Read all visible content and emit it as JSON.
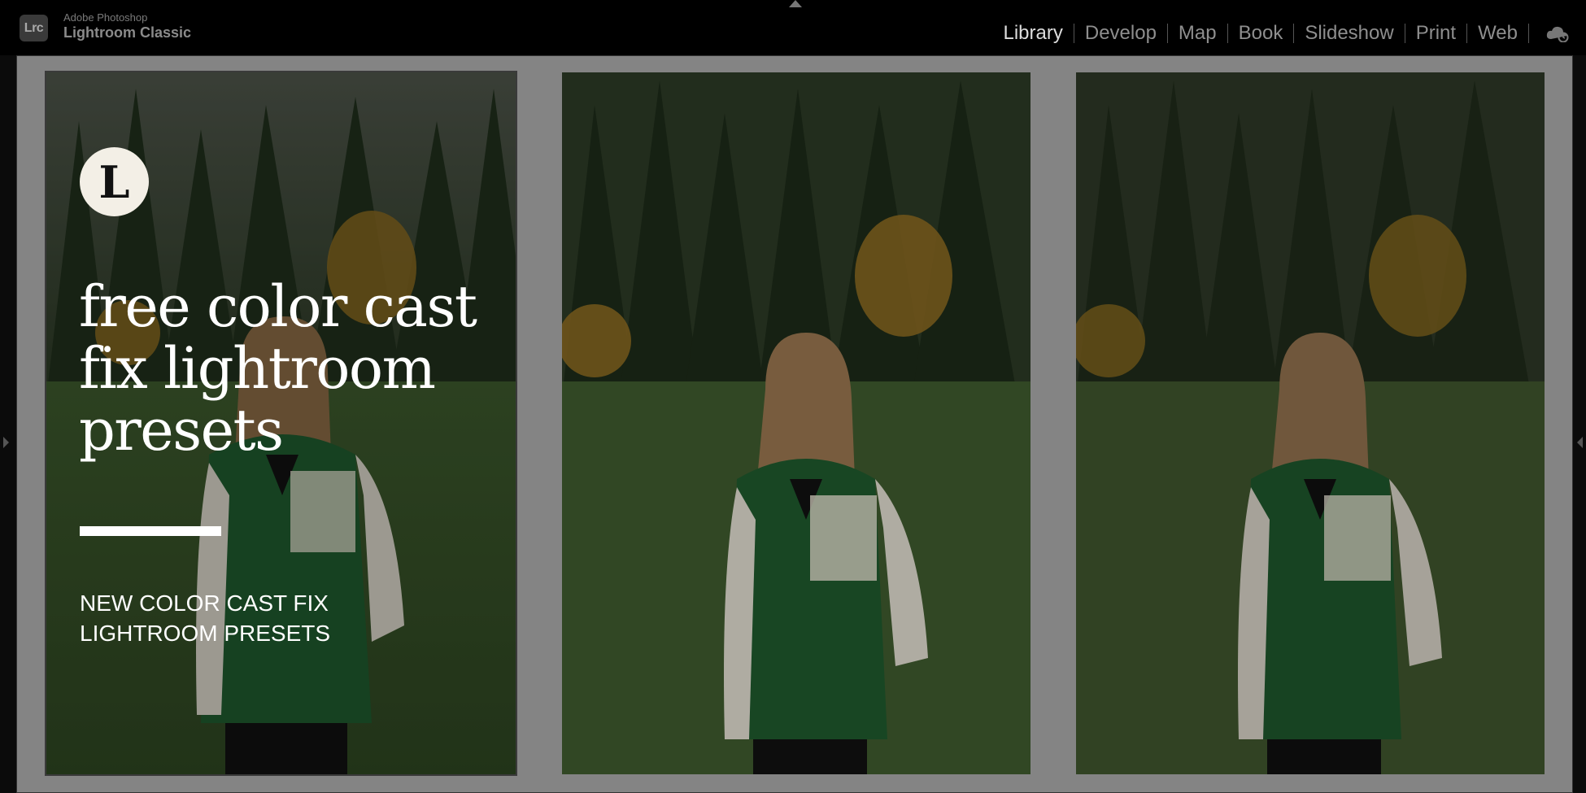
{
  "app": {
    "badge": "Lrc",
    "vendor": "Adobe Photoshop",
    "name": "Lightroom Classic"
  },
  "modules": [
    {
      "label": "Library",
      "active": true
    },
    {
      "label": "Develop",
      "active": false
    },
    {
      "label": "Map",
      "active": false
    },
    {
      "label": "Book",
      "active": false
    },
    {
      "label": "Slideshow",
      "active": false
    },
    {
      "label": "Print",
      "active": false
    },
    {
      "label": "Web",
      "active": false
    }
  ],
  "icons": {
    "cloud": "cloud-sync-icon",
    "collapse_top": "panel-collapse-top-icon",
    "collapse_left": "panel-collapse-left-icon",
    "collapse_right": "panel-collapse-right-icon"
  },
  "colors": {
    "active_module": "#dcdcdc",
    "inactive_module": "#8e8e8e",
    "grid_background": "#848484",
    "jacket_green": "#1f5a2e"
  },
  "grid": {
    "thumbnails": [
      {
        "name": "thumbnail-1",
        "overlay": {
          "logo_letter": "L",
          "headline": "free color cast\nfix lightroom\npresets",
          "subheadline": "NEW COLOR CAST FIX\nLIGHTROOM PRESETS"
        }
      },
      {
        "name": "thumbnail-2"
      },
      {
        "name": "thumbnail-3"
      }
    ]
  }
}
